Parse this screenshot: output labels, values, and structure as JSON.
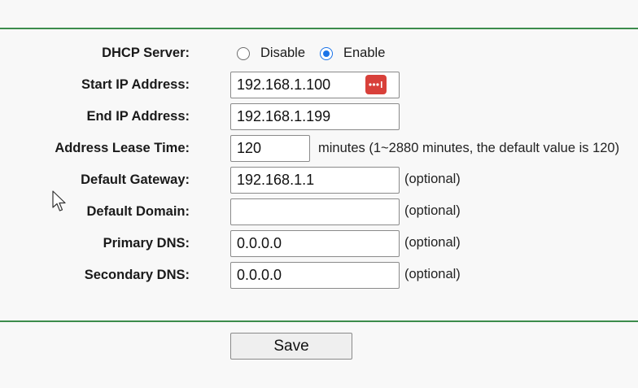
{
  "form": {
    "dhcp_server": {
      "label": "DHCP Server:",
      "options": [
        {
          "label": "Disable",
          "checked": false
        },
        {
          "label": "Enable",
          "checked": true
        }
      ]
    },
    "start_ip": {
      "label": "Start IP Address:",
      "value": "192.168.1.100",
      "icon": "password-manager-icon"
    },
    "end_ip": {
      "label": "End IP Address:",
      "value": "192.168.1.199"
    },
    "lease_time": {
      "label": "Address Lease Time:",
      "value": "120",
      "hint": "minutes (1~2880 minutes, the default value is 120)"
    },
    "gateway": {
      "label": "Default Gateway:",
      "value": "192.168.1.1",
      "hint": "(optional)"
    },
    "domain": {
      "label": "Default Domain:",
      "value": "",
      "hint": "(optional)"
    },
    "primary_dns": {
      "label": "Primary DNS:",
      "value": "0.0.0.0",
      "hint": "(optional)"
    },
    "secondary_dns": {
      "label": "Secondary DNS:",
      "value": "0.0.0.0",
      "hint": "(optional)"
    }
  },
  "actions": {
    "save_label": "Save"
  },
  "colors": {
    "rule": "#3c8c4c",
    "radio_accent": "#1a73e8",
    "password_icon": "#d8403a"
  }
}
